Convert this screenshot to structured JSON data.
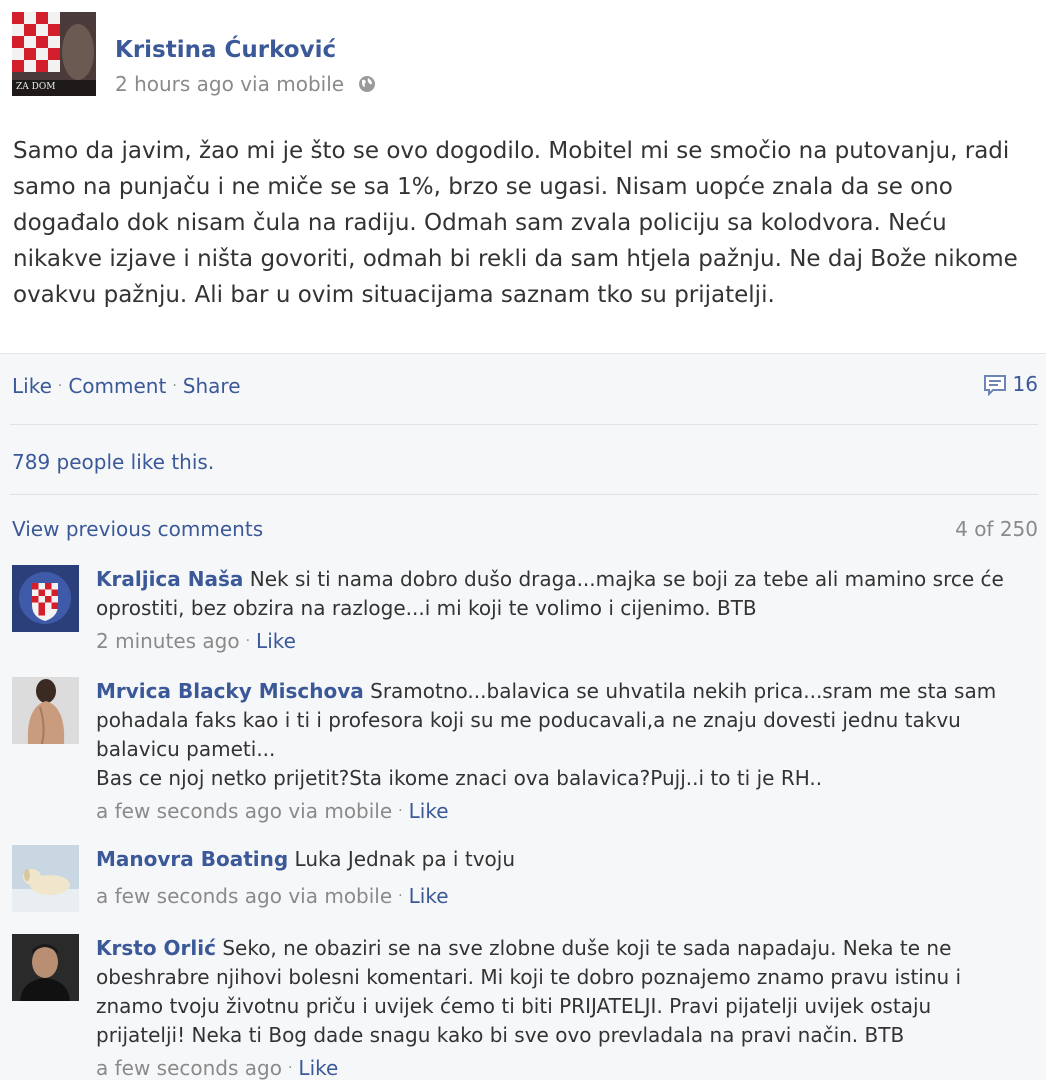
{
  "post": {
    "author": "Kristina Ćurković",
    "time": "2 hours ago via mobile",
    "text": "Samo da javim, žao mi je što se ovo dogodilo. Mobitel mi se smočio na putovanju, radi samo na punjaču i ne miče se sa 1%, brzo se ugasi. Nisam uopće znala da se ono događalo dok nisam čula na radiju. Odmah sam zvala policiju sa kolodvora. Neću nikakve izjave i ništa govoriti, odmah bi rekli da sam htjela pažnju. Ne daj Bože nikome ovakvu pažnju. Ali bar u ovim situacijama saznam tko su prijatelji.",
    "avatar_text": "ZA DOM"
  },
  "actions": {
    "like": "Like",
    "comment": "Comment",
    "share": "Share",
    "comment_count": "16"
  },
  "likes_text": "789 people like this.",
  "comments_header": {
    "view_previous": "View previous comments",
    "range": "4 of 250"
  },
  "comments": [
    {
      "author": "Kraljica Naša",
      "text": "Nek si ti nama dobro dušo draga...majka se boji za tebe ali mamino srce će oprostiti, bez obzira na razloge...i mi koji te volimo i cijenimo. BTB",
      "time": "2 minutes ago",
      "like": "Like"
    },
    {
      "author": "Mrvica Blacky Mischova",
      "text": "Sramotno...balavica se uhvatila nekih prica...sram me sta sam pohadala faks kao i ti i profesora koji su me poducavali,a ne znaju dovesti jednu takvu balavicu pameti...",
      "text2": "Bas ce njoj netko prijetit?Sta ikome znaci ova balavica?Pujj..i to ti je RH..",
      "time": "a few seconds ago via mobile",
      "like": "Like"
    },
    {
      "author": "Manovra Boating",
      "text": "Luka Jednak pa i tvoju",
      "time": "a few seconds ago via mobile",
      "like": "Like"
    },
    {
      "author": "Krsto Orlić",
      "text": "Seko, ne obaziri se na sve zlobne duše koji te sada napadaju. Neka te ne obeshrabre njihovi bolesni komentari. Mi koji te dobro poznajemo znamo pravu istinu i znamo tvoju životnu priču i uvijek ćemo ti biti PRIJATELJI. Pravi pijatelji uvijek ostaju prijatelji! Neka ti Bog dade snagu kako bi sve ovo prevladala na pravi način. BTB",
      "time": "a few seconds ago",
      "like": "Like"
    }
  ],
  "colors": {
    "link": "#3b5998",
    "meta": "#8a8a8a",
    "feedback_bg": "#f6f7f9"
  }
}
